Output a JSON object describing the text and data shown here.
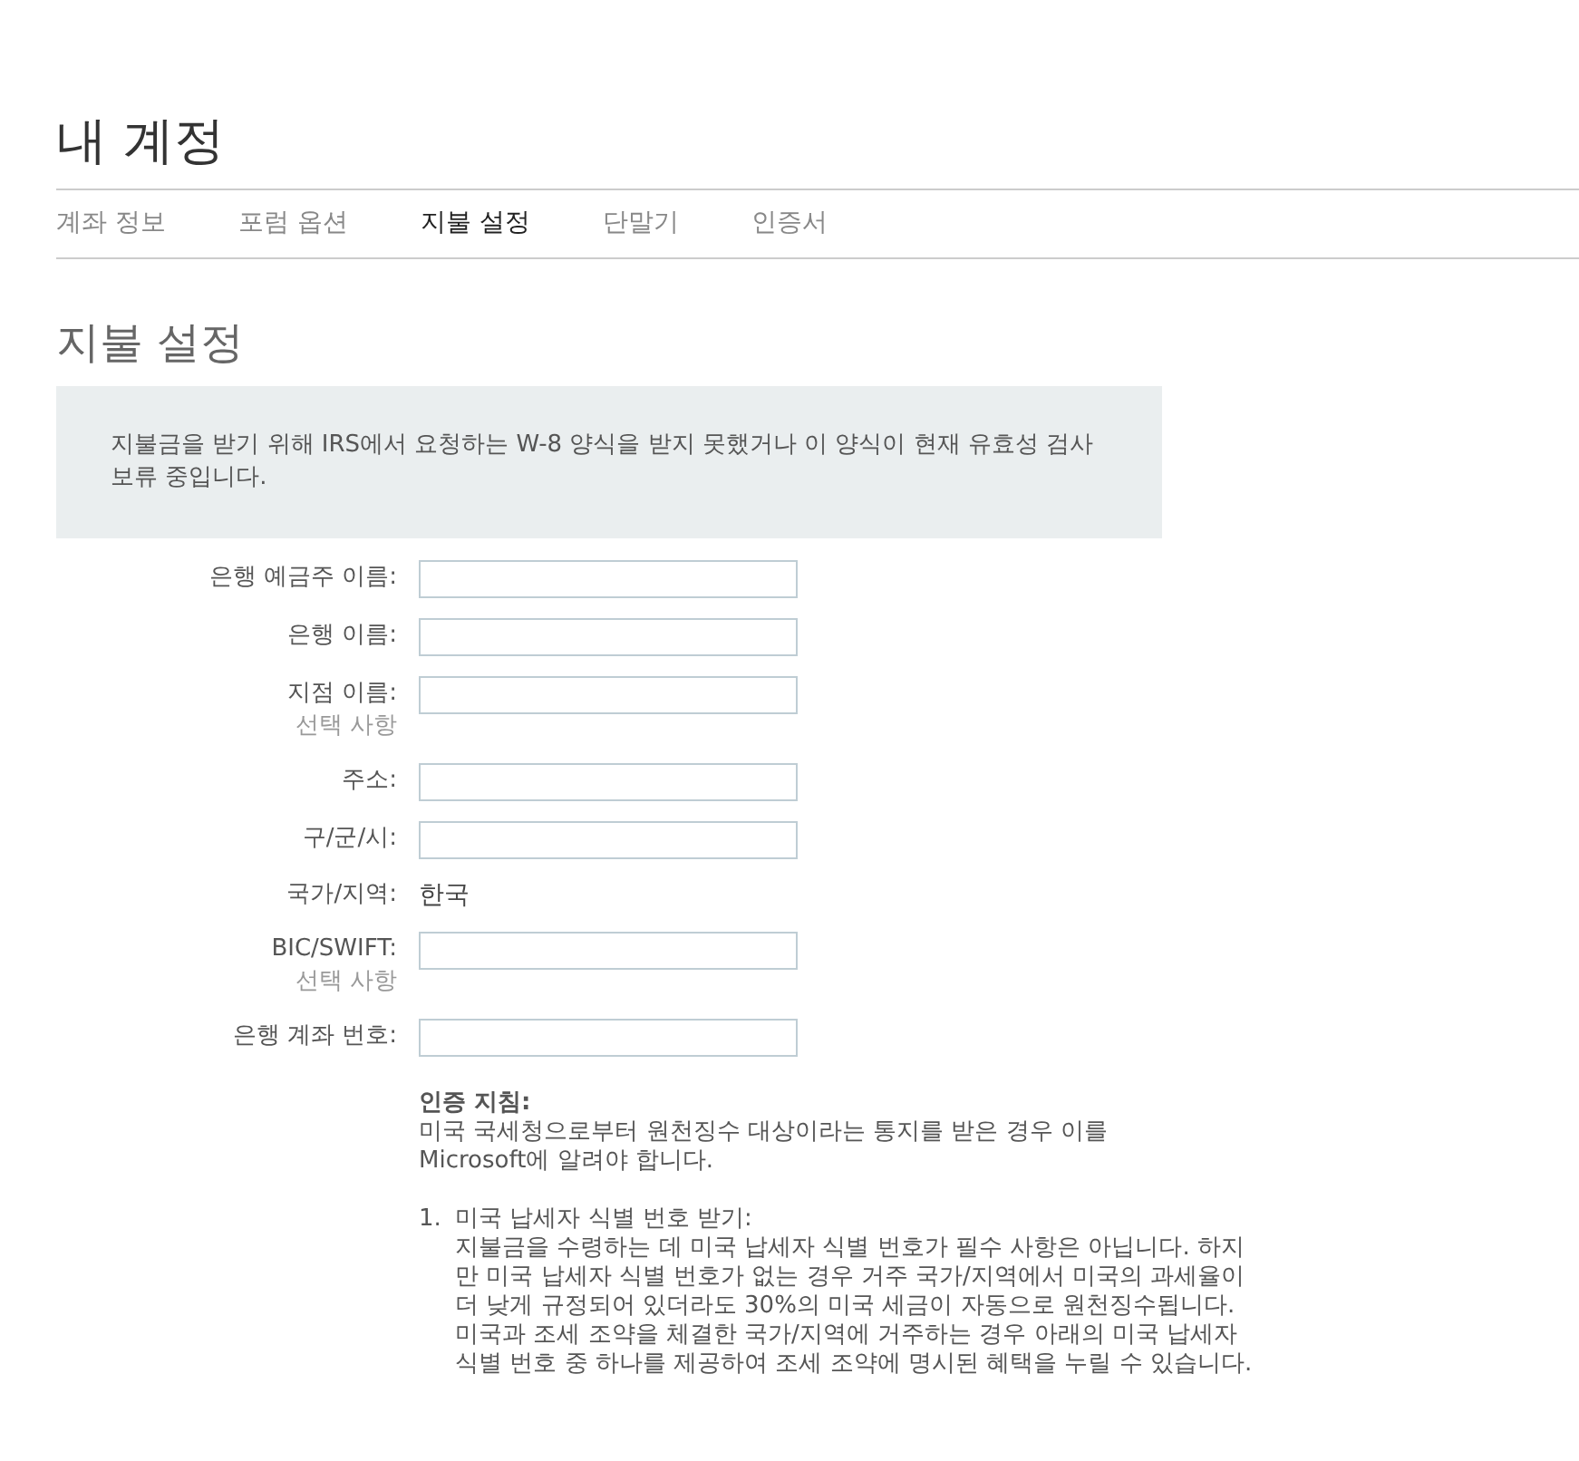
{
  "page_title": "내 계정",
  "tabs": [
    {
      "label": "계좌 정보",
      "selected": false
    },
    {
      "label": "포럼 옵션",
      "selected": false
    },
    {
      "label": "지불 설정",
      "selected": true
    },
    {
      "label": "단말기",
      "selected": false
    },
    {
      "label": "인증서",
      "selected": false
    }
  ],
  "section_title": "지불 설정",
  "notice": "지불금을 받기 위해 IRS에서 요청하는 W-8 양식을 받지 못했거나 이 양식이 현재 유효성 검사 보류 중입니다.",
  "form": [
    {
      "label": "은행 예금주 이름:",
      "kind": "input"
    },
    {
      "label": "은행 이름:",
      "kind": "input"
    },
    {
      "label": "지점 이름:",
      "kind": "input",
      "note": "선택 사항"
    },
    {
      "label": "주소:",
      "kind": "input"
    },
    {
      "label": "구/군/시:",
      "kind": "input"
    },
    {
      "label": "국가/지역:",
      "kind": "text",
      "value": "한국"
    },
    {
      "label": "BIC/SWIFT:",
      "kind": "input",
      "note": "선택 사항"
    },
    {
      "label": "은행 계좌 번호:",
      "kind": "input"
    }
  ],
  "instructions": {
    "title": "인증 지침:",
    "intro": "미국 국세청으로부터 원천징수 대상이라는 통지를 받은 경우 이를 Microsoft에 알려야 합니다.",
    "steps": [
      {
        "number": "1.",
        "title": "미국 납세자 식별 번호 받기:",
        "paragraphs": [
          "지불금을 수령하는 데 미국 납세자 식별 번호가 필수 사항은 아닙니다. 하지만 미국 납세자 식별 번호가 없는 경우 거주 국가/지역에서 미국의 과세율이 더 낮게 규정되어 있더라도 30%의 미국 세금이 자동으로 원천징수됩니다.",
          "미국과 조세 조약을 체결한 국가/지역에 거주하는 경우 아래의 미국 납세자 식별 번호 중 하나를 제공하여 조세 조약에 명시된 혜택을 누릴 수 있습니다."
        ]
      }
    ]
  }
}
